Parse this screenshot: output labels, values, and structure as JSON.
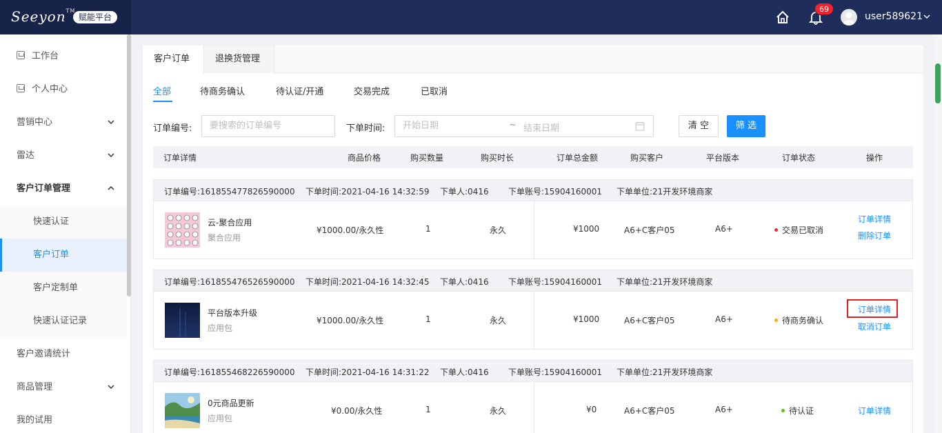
{
  "brand": {
    "logo_text": "Seeyon",
    "logo_tm": "TM",
    "badge": "赋能平台"
  },
  "header": {
    "notification_count": "69",
    "username": "user589621"
  },
  "sidebar": {
    "items": [
      {
        "label": "工作台"
      },
      {
        "label": "个人中心"
      },
      {
        "label": "营销中心"
      },
      {
        "label": "雷达"
      },
      {
        "label": "客户订单管理"
      },
      {
        "label": "快速认证"
      },
      {
        "label": "客户订单"
      },
      {
        "label": "客户定制单"
      },
      {
        "label": "快速认证记录"
      },
      {
        "label": "客户邀请统计"
      },
      {
        "label": "商品管理"
      },
      {
        "label": "我的试用"
      }
    ]
  },
  "tabs": {
    "t1": "客户订单",
    "t2": "退换货管理"
  },
  "status_tabs": {
    "all": "全部",
    "pending_business": "待商务确认",
    "pending_cert": "待认证/开通",
    "done": "交易完成",
    "cancelled": "已取消"
  },
  "filters": {
    "order_no_label": "订单编号:",
    "order_no_placeholder": "要搜索的订单编号",
    "time_label": "下单时间:",
    "start_placeholder": "开始日期",
    "sep": "~",
    "end_placeholder": "结束日期",
    "clear": "清 空",
    "filter": "筛 选"
  },
  "columns": {
    "detail": "订单详情",
    "price": "商品价格",
    "qty": "购买数量",
    "duration": "购买时长",
    "total": "订单总金额",
    "customer": "购买客户",
    "version": "平台版本",
    "status": "订单状态",
    "op": "操作"
  },
  "orders": [
    {
      "order_no": "订单编号:161855477826590000",
      "time": "下单时间:2021-04-16 14:32:59",
      "person": "下单人:0416",
      "account": "下单账号:15904160001",
      "unit": "下单单位:21开发环境商家",
      "product": "云-聚合应用",
      "ptype": "聚合应用",
      "price": "¥1000.00/永久性",
      "qty": "1",
      "duration": "永久",
      "total": "¥1000",
      "customer": "A6+C客户05",
      "version": "A6+",
      "status": "交易已取消",
      "status_color": "#f5222d",
      "link1": "订单详情",
      "link2": "删除订单"
    },
    {
      "order_no": "订单编号:161855476526590000",
      "time": "下单时间:2021-04-16 14:32:45",
      "person": "下单人:0416",
      "account": "下单账号:15904160001",
      "unit": "下单单位:21开发环境商家",
      "product": "平台版本升级",
      "ptype": "应用包",
      "price": "¥1000.00/永久性",
      "qty": "1",
      "duration": "永久",
      "total": "¥1000",
      "customer": "A6+C客户05",
      "version": "A6+",
      "status": "待商务确认",
      "status_color": "#faad14",
      "link1": "订单详情",
      "link2": "取消订单"
    },
    {
      "order_no": "订单编号:161855468226590000",
      "time": "下单时间:2021-04-16 14:31:22",
      "person": "下单人:0416",
      "account": "下单账号:15904160001",
      "unit": "下单单位:21开发环境商家",
      "product": "0元商品更新",
      "ptype": "应用包",
      "price": "¥0.00/永久性",
      "qty": "1",
      "duration": "永久",
      "total": "¥0",
      "customer": "A6+C客户05",
      "version": "A6+",
      "status": "待认证",
      "status_color": "#52c41a",
      "link1": "订单详情"
    }
  ]
}
